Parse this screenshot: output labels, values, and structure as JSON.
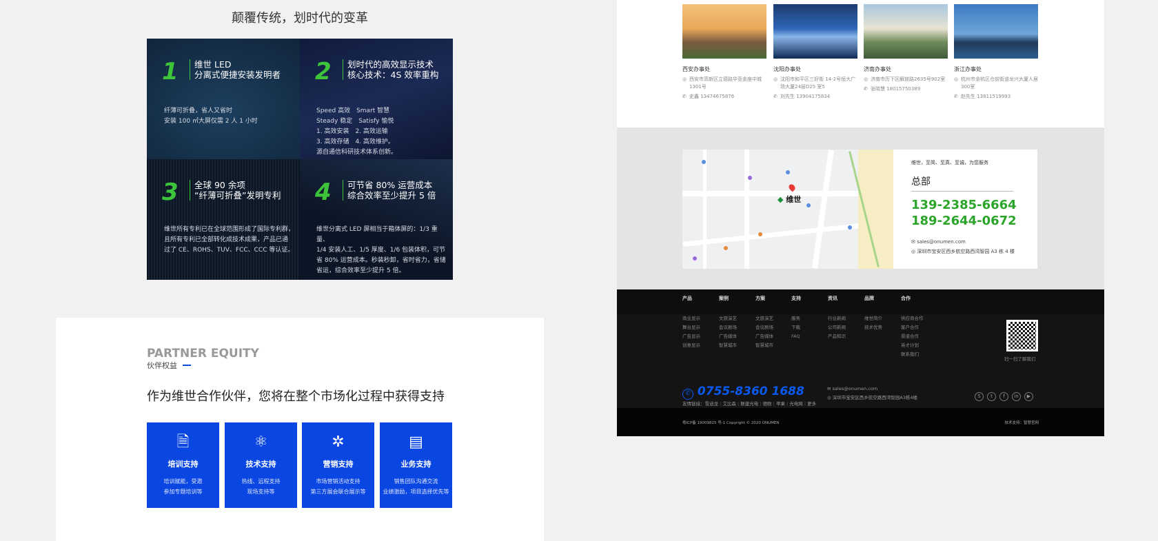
{
  "innovation": {
    "title": "颠覆传统，划时代的变革",
    "quads": [
      {
        "num": "1",
        "head1": "维世 LED",
        "head2": "分离式便捷安装发明者",
        "body": [
          "纤薄可折叠，省人又省时",
          "安装 100 ㎡大屏仅需 2 人 1 小时"
        ]
      },
      {
        "num": "2",
        "head1": "划时代的高效显示技术",
        "head2": "核心技术：4S 效率重构",
        "body": [
          "Speed 高效　Smart 智慧",
          "Steady 稳定　Satisfy 愉悦",
          "1. 高效安装　2. 高效运输",
          "3. 高效存储　4. 高效维护。",
          "源自通信科研技术体系创新。"
        ]
      },
      {
        "num": "3",
        "head1": "全球 90 余项",
        "head2": "“纤薄可折叠”发明专利",
        "body": [
          "维世所有专利已在全球范围形成了国际专利群，",
          "且所有专利已全部转化成技术成果，产品已通",
          "过了 CE、ROHS、TUV、FCC、CCC 等认证。"
        ]
      },
      {
        "num": "4",
        "head1": "可节省 80% 运营成本",
        "head2": "综合效率至少提升 5 倍",
        "body": [
          "维世分离式 LED 屏相当于箱体屏的：1/3 重量、",
          "1/4 安装人工、1/5 厚度、1/6 包装体积，可节",
          "省 80% 运营成本。秒装秒卸，省时省力，省储",
          "省运，综合效率至少提升 5 倍。"
        ]
      }
    ]
  },
  "partner": {
    "en": "PARTNER EQUITY",
    "cn": "伙伴权益",
    "heading": "作为维世合作伙伴，您将在整个市场化过程中获得支持",
    "cards": [
      {
        "icon": "training-certificate",
        "title": "培训支持",
        "l1": "培训赋能，受邀",
        "l2": "参加专题培训等"
      },
      {
        "icon": "atom",
        "title": "技术支持",
        "l1": "热线、远程支持",
        "l2": "现场支持等"
      },
      {
        "icon": "network",
        "title": "营销支持",
        "l1": "市场营销活动支持",
        "l2": "第三方展会联合展示等"
      },
      {
        "icon": "document-tray",
        "title": "业务支持",
        "l1": "销售团队沟通交流",
        "l2": "业绩激励，项目选择优先等"
      }
    ]
  },
  "offices": [
    {
      "name": "西安办事处",
      "addr": "西安市高新区立德路华亚金座中城 1301号",
      "phone": "史鑫 13474675876"
    },
    {
      "name": "沈阳办事处",
      "addr": "沈阳市和平区三好街 14-2号恒大广场大厦24层D25 室5",
      "phone": "刘先生 13904175834"
    },
    {
      "name": "济南办事处",
      "addr": "济南市历下区解放路2635号902室",
      "phone": "张晓慧 18015750389"
    },
    {
      "name": "浙江办事处",
      "addr": "杭州市余杭区仓前街道龙兴大厦人居300室",
      "phone": "赵先生 13811519993"
    }
  ],
  "hq": {
    "slogan": "维世，至简、至真、至诚，为您服务",
    "title": "总部",
    "phone1": "139-2385-6664",
    "phone2": "189-2644-0672",
    "email": "sales@onumen.com",
    "address": "深圳市宝安区西乡航空路西湾智园 A3 栋 4 楼",
    "map_logo": "维世",
    "accent": "#2aa52a"
  },
  "footer": {
    "columns": [
      {
        "head": "产品",
        "items": [
          "商业显示",
          "舞台显示",
          "广告显示",
          "创意显示"
        ]
      },
      {
        "head": "案例",
        "items": [
          "文旅演艺",
          "会议剧场",
          "广告媒体",
          "智慧城市"
        ]
      },
      {
        "head": "方案",
        "items": [
          "文旅演艺",
          "会议剧场",
          "广告媒体",
          "智慧城市"
        ]
      },
      {
        "head": "支持",
        "items": [
          "服务",
          "下载",
          "FAQ"
        ]
      },
      {
        "head": "资讯",
        "items": [
          "行业新闻",
          "公司新闻",
          "产品知识"
        ]
      },
      {
        "head": "品牌",
        "items": [
          "维世简介",
          "技术优势"
        ]
      },
      {
        "head": "合作",
        "items": [
          "供应商合作",
          "客户合作",
          "渠道合作",
          "英才计划",
          "联系我们"
        ]
      }
    ],
    "qr_caption": "扫一扫了解我们",
    "hotline": "0755-8360 1688",
    "email": "sales@onumen.com",
    "address": "深圳市宝安区西乡航空路西湾智园A3栋4楼",
    "social": [
      "skype",
      "twitter",
      "facebook",
      "linkedin",
      "youtube"
    ],
    "links_label": "友情链接：",
    "links": [
      "雪迪龙",
      "艾比森",
      "联建光电",
      "德欧",
      "苹果",
      "光电网",
      "更多"
    ],
    "copyright": "粤ICP备 19009825 号-1  Copyright © 2020  ONUMEN",
    "tech_support": "技术支持：智慧官网",
    "accent": "#0a5af0"
  }
}
